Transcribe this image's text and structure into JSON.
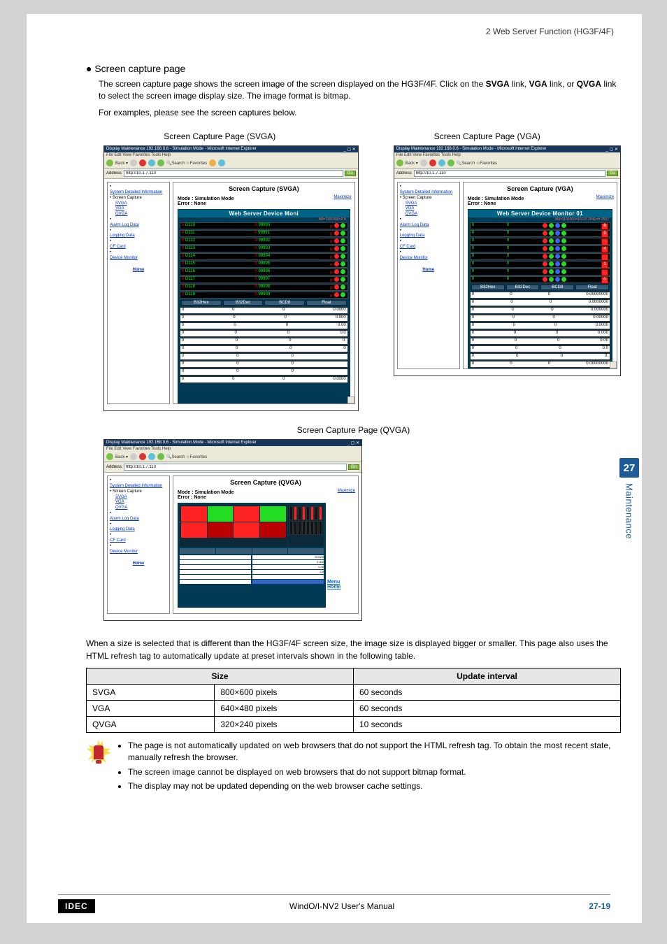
{
  "header": {
    "section": "2 Web Server Function (HG3F/4F)"
  },
  "heading": "● Screen capture page",
  "para1": "The screen capture page shows the screen image of the screen displayed on the HG3F/4F. Click on the SVGA link, VGA link, or QVGA link to select the screen image display size. The image format is bitmap.",
  "para1_plain_a": "The screen capture page shows the screen image of the screen displayed on the HG3F/4F. Click on the ",
  "para1_b1": "SVGA",
  "para1_mid1": " link, ",
  "para1_b2": "VGA",
  "para1_mid2": " link, or ",
  "para1_b3": "QVGA",
  "para1_end": " link to select the screen image display size. The image format is bitmap.",
  "para2": "For examples, please see the screen captures below.",
  "captions": {
    "svga": "Screen Capture Page (SVGA)",
    "vga": "Screen Capture Page (VGA)",
    "qvga": "Screen Capture Page (QVGA)"
  },
  "browser": {
    "title": "Display Maintenance 192.168.0.6 - Simulation Mode - Microsoft Internet Explorer",
    "menu": "File   Edit   View   Favorites   Tools   Help",
    "addr_label": "Address",
    "addr_value": "http://10.1.7.110",
    "go": "Go"
  },
  "sidenav": {
    "sysdetail": "System Detailed Information",
    "screencap": "Screen Capture",
    "svga": "SVGA",
    "vga": "VGA",
    "qvga": "QVGA",
    "alarm": "Alarm Log Data",
    "logging": "Logging Data",
    "cf": "CF Card",
    "device": "Device Monitor",
    "home": "Home"
  },
  "panel": {
    "title_svga": "Screen Capture (SVGA)",
    "title_vga": "Screen Capture (VGA)",
    "title_qvga": "Screen Capture (QVGA)",
    "maximize": "Maximize",
    "mode": "Mode : Simulation Mode",
    "error": "Error : None",
    "devtitle_svga": "Web Server Device Moni",
    "devtitle_vga": "Web Server Device Monitor 01",
    "tabs": [
      "B32Hex",
      "B32Dec",
      "BCD8",
      "Float"
    ],
    "rows_svga": [
      {
        "a": "0",
        "b": "D110",
        "c": "0",
        "d": "99990"
      },
      {
        "a": "0",
        "b": "D111",
        "c": "0",
        "d": "99991"
      },
      {
        "a": "0",
        "b": "D112",
        "c": "0",
        "d": "99992"
      },
      {
        "a": "0",
        "b": "D113",
        "c": "0",
        "d": "99993"
      },
      {
        "a": "0",
        "b": "D114",
        "c": "0",
        "d": "99994"
      },
      {
        "a": "0",
        "b": "D115",
        "c": "0",
        "d": "99995"
      },
      {
        "a": "0",
        "b": "D116",
        "c": "0",
        "d": "99996"
      },
      {
        "a": "0",
        "b": "D117",
        "c": "0",
        "d": "99997"
      },
      {
        "a": "0",
        "b": "D118",
        "c": "0",
        "d": "99998"
      },
      {
        "a": "0",
        "b": "D119",
        "c": "0",
        "d": "99999"
      }
    ],
    "white_rows": [
      "0.0000",
      "0.000",
      "0.00",
      "0.0",
      "0.",
      "0",
      "",
      "",
      "",
      "0.0000"
    ],
    "vga_side": [
      "8",
      "9",
      "4",
      "1",
      "0"
    ],
    "vga_floats": [
      "0.00000000",
      "0.0000000",
      "0.000000",
      "0.00000",
      "0.0000",
      "0.000",
      "0.00",
      "0.0",
      "0.",
      "0.00000000"
    ],
    "menu": "Menu",
    "home": "Home"
  },
  "aftertext1": "When a size is selected that is different than the HG3F/4F screen size, the image size is displayed bigger or smaller. This page also uses the HTML refresh tag to automatically update at preset intervals shown in the following table.",
  "table": {
    "h1": "Size",
    "h2": "Update interval",
    "rows": [
      {
        "s": "SVGA",
        "px": "800×600 pixels",
        "int": "60 seconds"
      },
      {
        "s": "VGA",
        "px": "640×480 pixels",
        "int": "60 seconds"
      },
      {
        "s": "QVGA",
        "px": "320×240 pixels",
        "int": "10 seconds"
      }
    ]
  },
  "notes": [
    "The page is not automatically updated on web browsers that do not support the HTML refresh tag. To obtain the most recent state, manually refresh the browser.",
    "The screen image cannot be displayed on web browsers that do not support bitmap format.",
    "The display may not be updated depending on the web browser cache settings."
  ],
  "sidetab": {
    "num": "27",
    "label": "Maintenance"
  },
  "footer": {
    "idec": "IDEC",
    "title": "WindO/I-NV2 User's Manual",
    "page_strong": "27-19"
  }
}
